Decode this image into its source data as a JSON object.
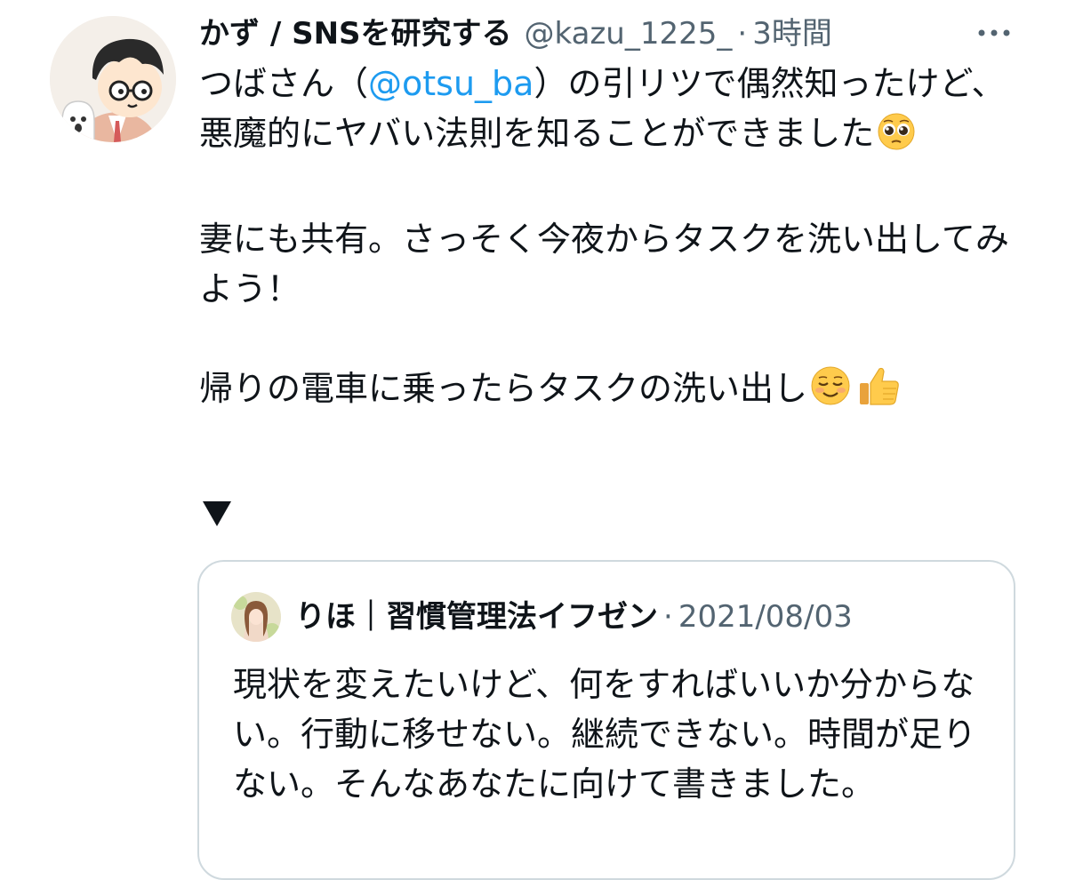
{
  "tweet": {
    "author": {
      "display_name": "かず / SNSを研究する",
      "handle": "@kazu_1225_",
      "separator": "·",
      "time": "3時間"
    },
    "body": {
      "p1": {
        "pre": "つばさん（",
        "mention": "@otsu_ba",
        "post": "）の引リツで偶然知ったけど、悪魔的にヤバい法則を知ることができました"
      },
      "p2": "妻にも共有。さっそく今夜からタスクを洗い出してみよう！",
      "p3": "帰りの電車に乗ったらタスクの洗い出し",
      "arrow": "▼"
    },
    "icons": {
      "more": "more-horizontal-icon",
      "emoji_pleading": "pleading-face-emoji",
      "emoji_smiling": "smiling-face-emoji",
      "emoji_thumbs": "thumbs-up-emoji"
    },
    "colors": {
      "text": "#0f1419",
      "secondary": "#536471",
      "link": "#1d9bf0",
      "border": "#cfd9de"
    }
  },
  "quoted_tweet": {
    "display_name": "りほ｜習慣管理法イフゼン",
    "separator": "·",
    "date": "2021/08/03",
    "text": "現状を変えたいけど、何をすればいいか分からない。行動に移せない。継続できない。時間が足りない。そんなあなたに向けて書きました。"
  }
}
